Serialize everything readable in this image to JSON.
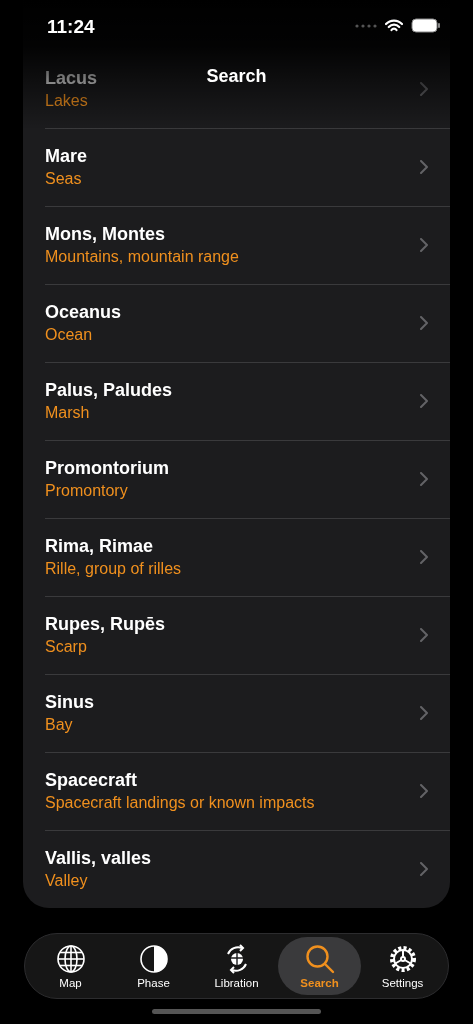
{
  "status_bar": {
    "time": "11:24"
  },
  "title": "Search",
  "rows": [
    {
      "title": "Lacus",
      "subtitle": "Lakes"
    },
    {
      "title": "Mare",
      "subtitle": "Seas"
    },
    {
      "title": "Mons, Montes",
      "subtitle": "Mountains, mountain range"
    },
    {
      "title": "Oceanus",
      "subtitle": "Ocean"
    },
    {
      "title": "Palus, Paludes",
      "subtitle": "Marsh"
    },
    {
      "title": "Promontorium",
      "subtitle": "Promontory"
    },
    {
      "title": "Rima, Rimae",
      "subtitle": "Rille, group of rilles"
    },
    {
      "title": "Rupes, Rupēs",
      "subtitle": "Scarp"
    },
    {
      "title": "Sinus",
      "subtitle": "Bay"
    },
    {
      "title": "Spacecraft",
      "subtitle": "Spacecraft landings or known impacts"
    },
    {
      "title": "Vallis, valles",
      "subtitle": "Valley"
    }
  ],
  "tabs": [
    {
      "label": "Map",
      "kind": "globe",
      "selected": false
    },
    {
      "label": "Phase",
      "kind": "phase",
      "selected": false
    },
    {
      "label": "Libration",
      "kind": "libration",
      "selected": false
    },
    {
      "label": "Search",
      "kind": "search",
      "selected": true
    },
    {
      "label": "Settings",
      "kind": "gear",
      "selected": false
    }
  ]
}
